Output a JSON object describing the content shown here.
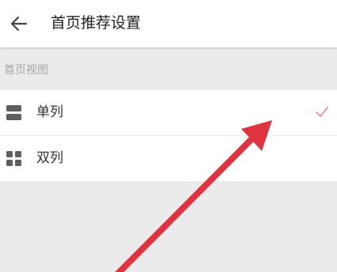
{
  "header": {
    "back_icon": "back-arrow-icon",
    "title": "首页推荐设置"
  },
  "section": {
    "label": "首页视图"
  },
  "options": [
    {
      "label": "单列",
      "icon": "single-column-icon",
      "selected": true
    },
    {
      "label": "双列",
      "icon": "double-column-icon",
      "selected": false
    }
  ],
  "colors": {
    "check": "#f08fa0",
    "annotation_arrow": "#e0323f",
    "icon": "#5f5f5f"
  }
}
